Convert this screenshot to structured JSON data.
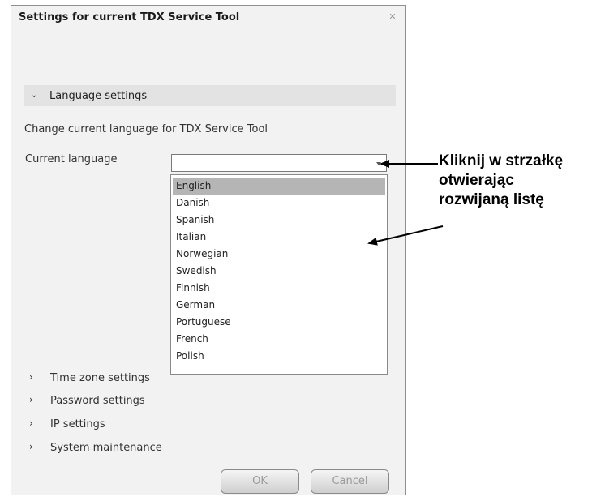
{
  "window": {
    "title": "Settings for current TDX Service Tool",
    "close_icon": "close-icon"
  },
  "language_section": {
    "title": "Language settings",
    "expanded": true,
    "description": "Change current language for TDX Service Tool",
    "field_label": "Current language",
    "current_value": "",
    "options": [
      "English",
      "Danish",
      "Spanish",
      "Italian",
      "Norwegian",
      "Swedish",
      "Finnish",
      "German",
      "Portuguese",
      "French",
      "Polish"
    ],
    "highlighted_option": "English"
  },
  "sections": [
    {
      "title": "Time zone settings"
    },
    {
      "title": "Password settings"
    },
    {
      "title": "IP settings"
    },
    {
      "title": "System maintenance"
    }
  ],
  "buttons": {
    "ok": "OK",
    "cancel": "Cancel"
  },
  "annotation": {
    "lines": [
      "Kliknij w strzałkę",
      "otwierając",
      "rozwijaną listę"
    ]
  }
}
